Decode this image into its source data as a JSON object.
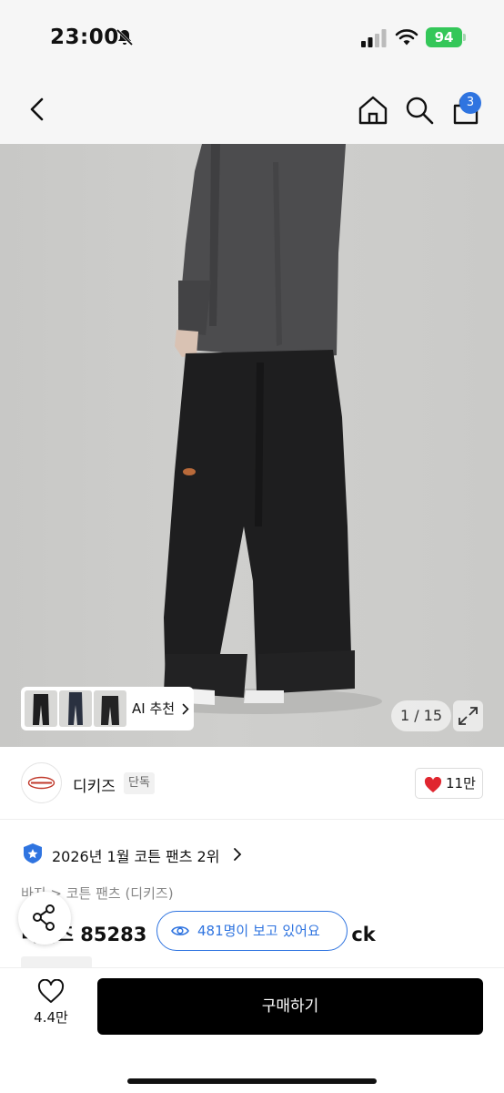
{
  "status_bar": {
    "time": "23:00",
    "battery": "94"
  },
  "nav": {
    "cart_count": "3",
    "icons": [
      "back-chevron-icon",
      "home-icon",
      "search-icon",
      "cart-icon"
    ]
  },
  "gallery": {
    "ai_recommend_label": "AI 추천",
    "counter": "1 / 15",
    "thumbnail_count": 3
  },
  "brand": {
    "name": "디키즈",
    "tag": "단독",
    "like_count": "11만"
  },
  "ranking": {
    "text": "2026년 1월 코튼 팬츠 2위"
  },
  "breadcrumb": "바지 > 코튼 팬츠 (디키즈)",
  "product": {
    "title_prefix": "디키즈 85283",
    "title_suffix": "ck"
  },
  "watching": {
    "text": "481명이 보고 있어요"
  },
  "bottom_bar": {
    "favorite_count": "4.4만",
    "buy_label": "구매하기"
  },
  "colors": {
    "accent_blue": "#2f74e0",
    "heart_red": "#e0262f",
    "buy_button": "#000000",
    "battery_green": "#34c759"
  }
}
